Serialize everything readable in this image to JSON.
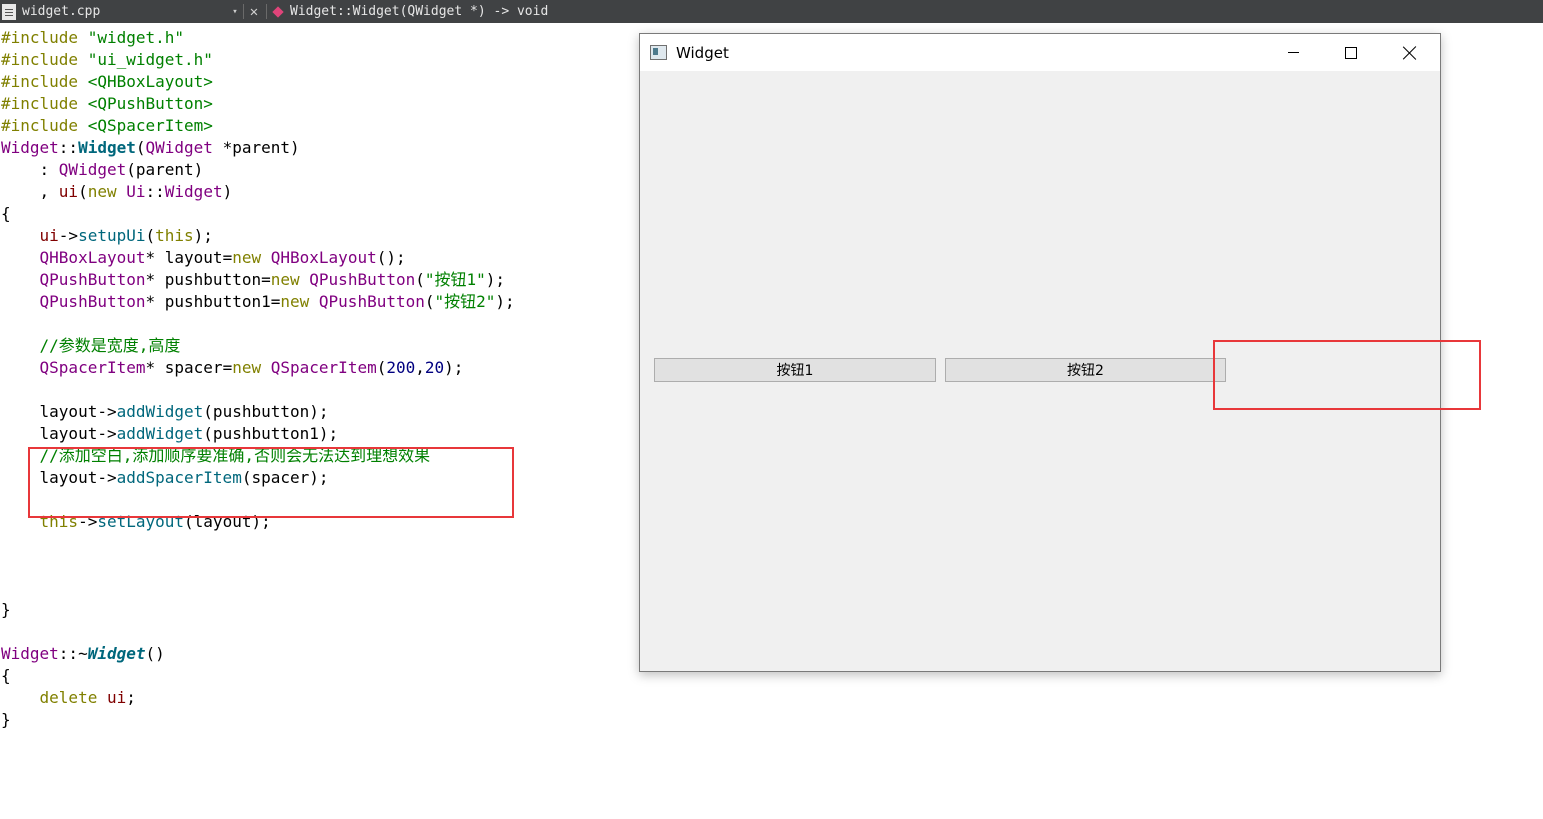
{
  "editor": {
    "file_name": "widget.cpp",
    "symbol": "Widget::Widget(QWidget *) -> void",
    "dropdown_glyph": "▾",
    "close_glyph": "✕"
  },
  "code": {
    "include_kw": "#include",
    "includes": [
      "\"widget.h\"",
      "\"ui_widget.h\"",
      "<QHBoxLayout>",
      "<QPushButton>",
      "<QSpacerItem>"
    ],
    "widget_cls": "Widget",
    "scope": "::",
    "ctor_name": "Widget",
    "qwidget": "QWidget",
    "param": " *parent)",
    "open_paren": "(",
    "init1_prefix": "    : ",
    "init1_args": "(parent)",
    "init2_prefix": "    , ",
    "ui_member": "ui",
    "new_kw": "new",
    "ui_ns": "Ui",
    "ui_widget": "Widget",
    "close_paren": ")",
    "brace_open": "{",
    "brace_close": "}",
    "indent": "    ",
    "ui": "ui",
    "arrow": "->",
    "setupUi": "setupUi",
    "this_kw": "this",
    "stmt_end": ");",
    "qhboxlayout": "QHBoxLayout",
    "layout_decl": "* layout=",
    "call_end": "();",
    "qpushbutton": "QPushButton",
    "pb_decl": "* pushbutton=",
    "pb1_decl": "* pushbutton1=",
    "str_btn1": "\"按钮1\"",
    "str_btn2": "\"按钮2\"",
    "comment1": "//参数是宽度,高度",
    "qspaceritem": "QSpacerItem",
    "spacer_decl": "* spacer=",
    "num_200": "200",
    "comma": ",",
    "num_20": "20",
    "layout": "layout",
    "addWidget": "addWidget",
    "pb_arg": "(pushbutton);",
    "pb1_arg": "(pushbutton1);",
    "comment2": "//添加空白,添加顺序要准确,否则会无法达到理想效果",
    "addSpacerItem": "addSpacerItem",
    "spacer_arg": "(spacer);",
    "setLayout": "setLayout",
    "layout_arg": "(layout);",
    "dtor_prefix": "::~",
    "dtor_name": "Widget",
    "empty_parens": "()",
    "delete_kw": "delete",
    "ui_end": ";"
  },
  "window": {
    "title": "Widget",
    "button1": "按钮1",
    "button2": "按钮2"
  },
  "colors": {
    "red_highlight": "#e8373a",
    "editor_bar": "#404244"
  }
}
